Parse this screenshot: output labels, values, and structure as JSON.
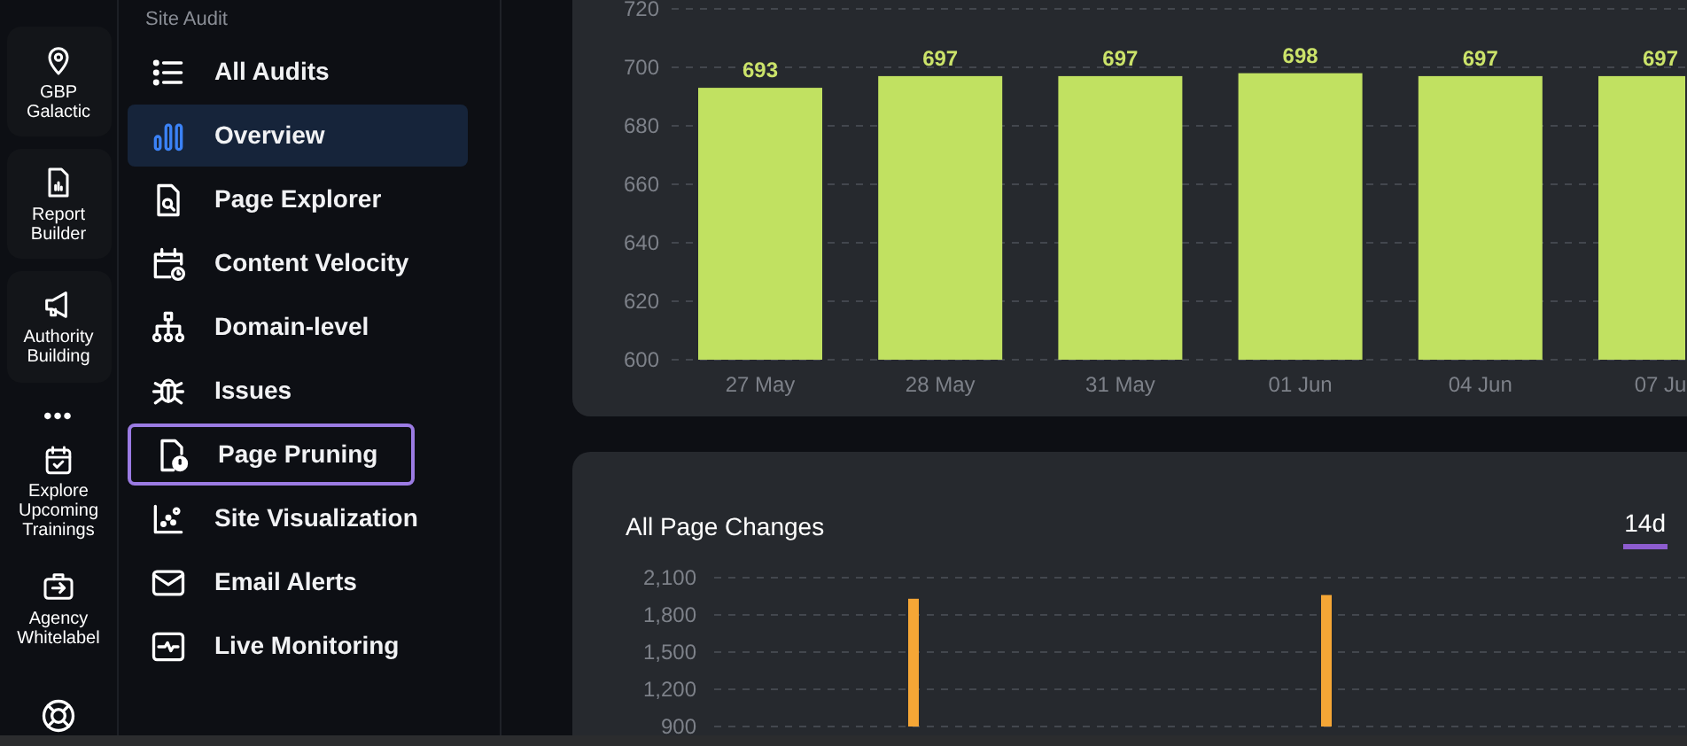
{
  "rail": {
    "items": [
      {
        "label": "GBP Galactic",
        "card": true
      },
      {
        "label": "Report Builder",
        "card": true
      },
      {
        "label": "Authority Building",
        "card": true
      },
      {
        "label": "•••",
        "kind": "more"
      },
      {
        "label": "Explore Upcoming Trainings",
        "card": false
      },
      {
        "label": "Agency Whitelabel",
        "card": false
      },
      {
        "kind": "help"
      }
    ]
  },
  "sidebar": {
    "heading": "Site Audit",
    "items": [
      {
        "label": "All Audits",
        "selected": false,
        "highlighted": false
      },
      {
        "label": "Overview",
        "selected": true,
        "highlighted": false
      },
      {
        "label": "Page Explorer",
        "selected": false,
        "highlighted": false
      },
      {
        "label": "Content Velocity",
        "selected": false,
        "highlighted": false
      },
      {
        "label": "Domain-level",
        "selected": false,
        "highlighted": false
      },
      {
        "label": "Issues",
        "selected": false,
        "highlighted": false
      },
      {
        "label": "Page Pruning",
        "selected": false,
        "highlighted": true
      },
      {
        "label": "Site Visualization",
        "selected": false,
        "highlighted": false
      },
      {
        "label": "Email Alerts",
        "selected": false,
        "highlighted": false
      },
      {
        "label": "Live Monitoring",
        "selected": false,
        "highlighted": false
      }
    ]
  },
  "pages_chart": {
    "chart_data": {
      "type": "bar",
      "categories": [
        "27 May",
        "28 May",
        "31 May",
        "01 Jun",
        "04 Jun",
        "07 Ju"
      ],
      "series": [
        {
          "color": "#c1e161",
          "values": [
            693,
            697,
            697,
            698,
            697,
            697
          ]
        }
      ],
      "ylim": [
        600,
        720
      ],
      "grid": true,
      "yticks": [
        600,
        620,
        640,
        660,
        680,
        700,
        720
      ],
      "data_labels": true
    }
  },
  "page_changes": {
    "title": "All Page Changes",
    "tabs": [
      {
        "label": "14d",
        "selected": true
      }
    ],
    "chart_data": {
      "type": "bar",
      "series": [
        {
          "color": "#f5a636",
          "values": [
            1930,
            1960
          ]
        }
      ],
      "ylim": [
        900,
        2100
      ],
      "grid": true,
      "yticks": [
        {
          "value": 900,
          "label": "900"
        },
        {
          "value": 1200,
          "label": "1,200"
        },
        {
          "value": 1500,
          "label": "1,500"
        },
        {
          "value": 1800,
          "label": "1,800"
        },
        {
          "value": 2100,
          "label": "2,100"
        }
      ]
    }
  }
}
